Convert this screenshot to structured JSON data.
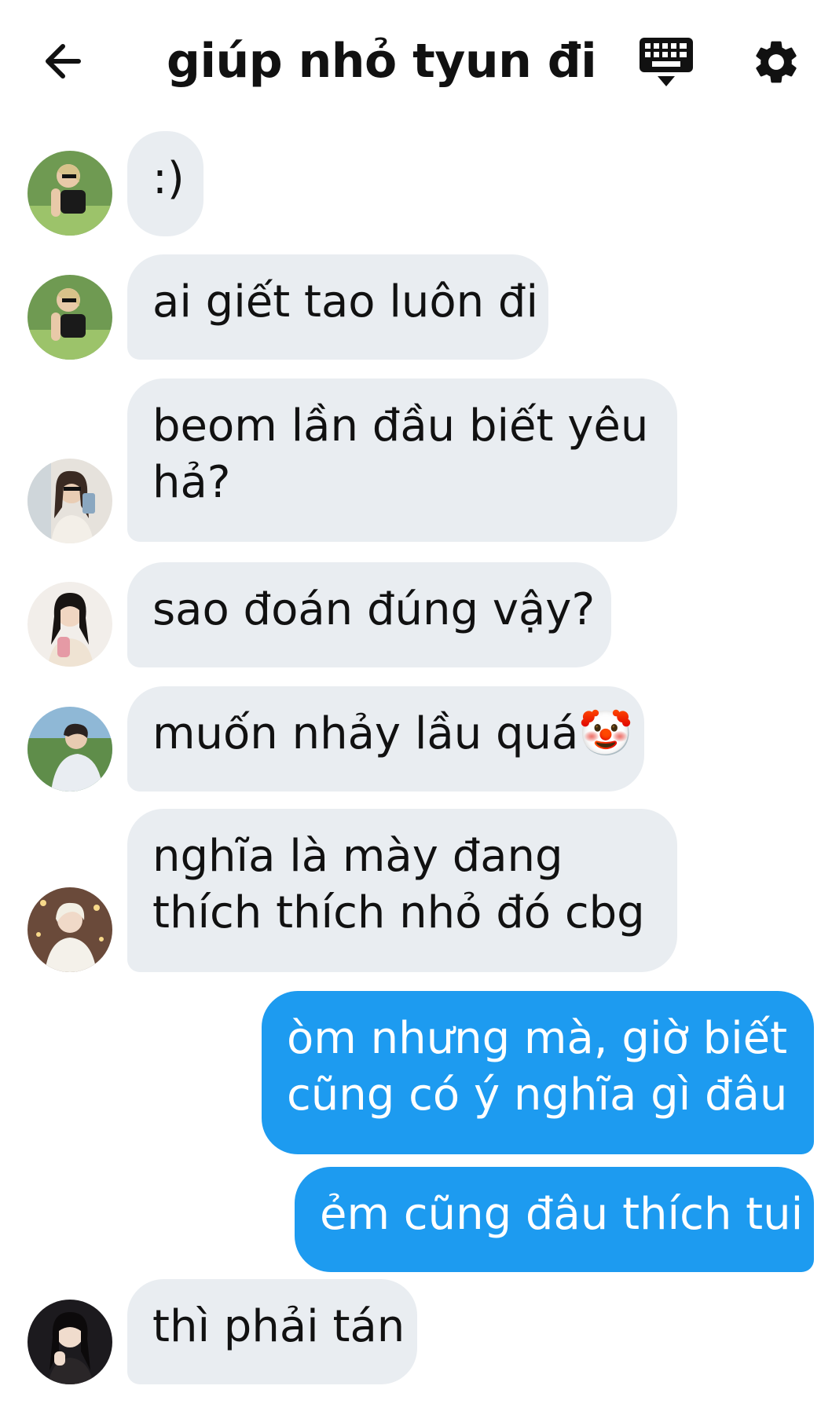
{
  "header": {
    "title": "giúp nhỏ tyun đi",
    "back_icon": "arrow-left-icon",
    "keyboard_icon": "keyboard-icon",
    "settings_icon": "gear-icon"
  },
  "colors": {
    "incoming_bubble": "#e9edf1",
    "outgoing_bubble": "#1d9bf0",
    "text": "#111111"
  },
  "messages": [
    {
      "direction": "in",
      "lines": [
        ":)"
      ]
    },
    {
      "direction": "in",
      "lines": [
        "ai giết tao luôn đi"
      ]
    },
    {
      "direction": "in",
      "lines": [
        "beom lần đầu biết yêu",
        "hả?"
      ]
    },
    {
      "direction": "in",
      "lines": [
        "sao đoán đúng vậy?"
      ]
    },
    {
      "direction": "in",
      "lines": [
        "muốn nhảy lầu quá🤡"
      ]
    },
    {
      "direction": "in",
      "lines": [
        "nghĩa là mày đang",
        "thích thích nhỏ đó cbg"
      ]
    },
    {
      "direction": "out",
      "lines": [
        "òm nhưng mà, giờ biết",
        "cũng có ý nghĩa gì đâu"
      ]
    },
    {
      "direction": "out",
      "lines": [
        "ẻm cũng đâu thích tui"
      ]
    },
    {
      "direction": "in",
      "lines": [
        "thì phải tán"
      ]
    }
  ]
}
